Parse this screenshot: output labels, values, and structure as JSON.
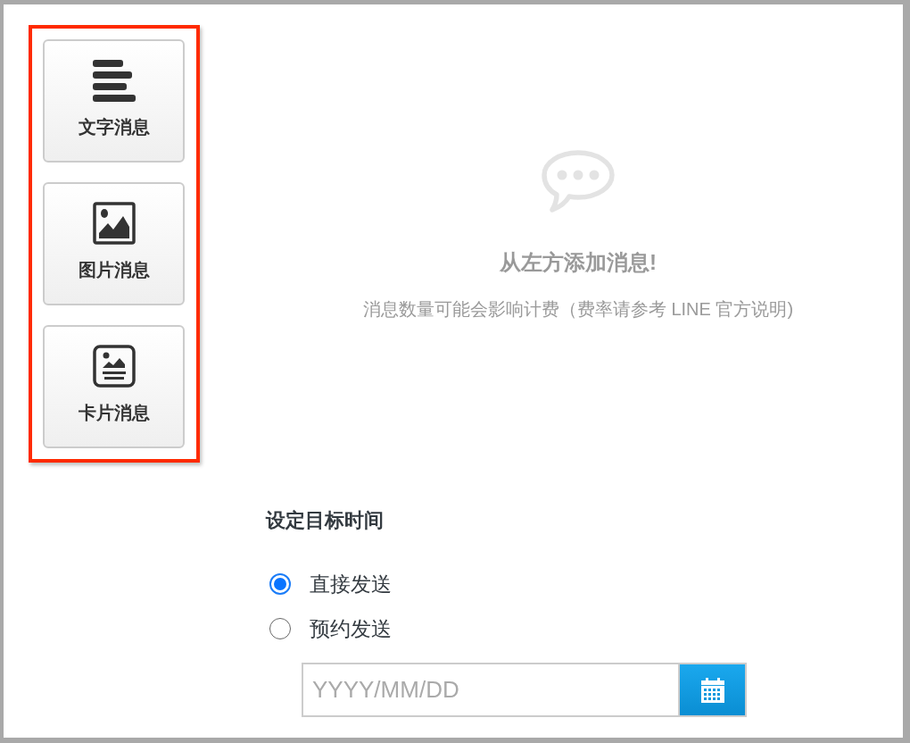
{
  "message_types": [
    {
      "kind": "text",
      "label": "文字消息"
    },
    {
      "kind": "image",
      "label": "图片消息"
    },
    {
      "kind": "card",
      "label": "卡片消息"
    }
  ],
  "empty_state": {
    "title": "从左方添加消息!",
    "note": "消息数量可能会影响计费（费率请参考 LINE 官方说明)"
  },
  "schedule": {
    "heading": "设定目标时间",
    "options": [
      {
        "label": "直接发送",
        "selected": true
      },
      {
        "label": "预约发送",
        "selected": false
      }
    ],
    "date_field": {
      "placeholder": "YYYY/MM/DD"
    }
  }
}
